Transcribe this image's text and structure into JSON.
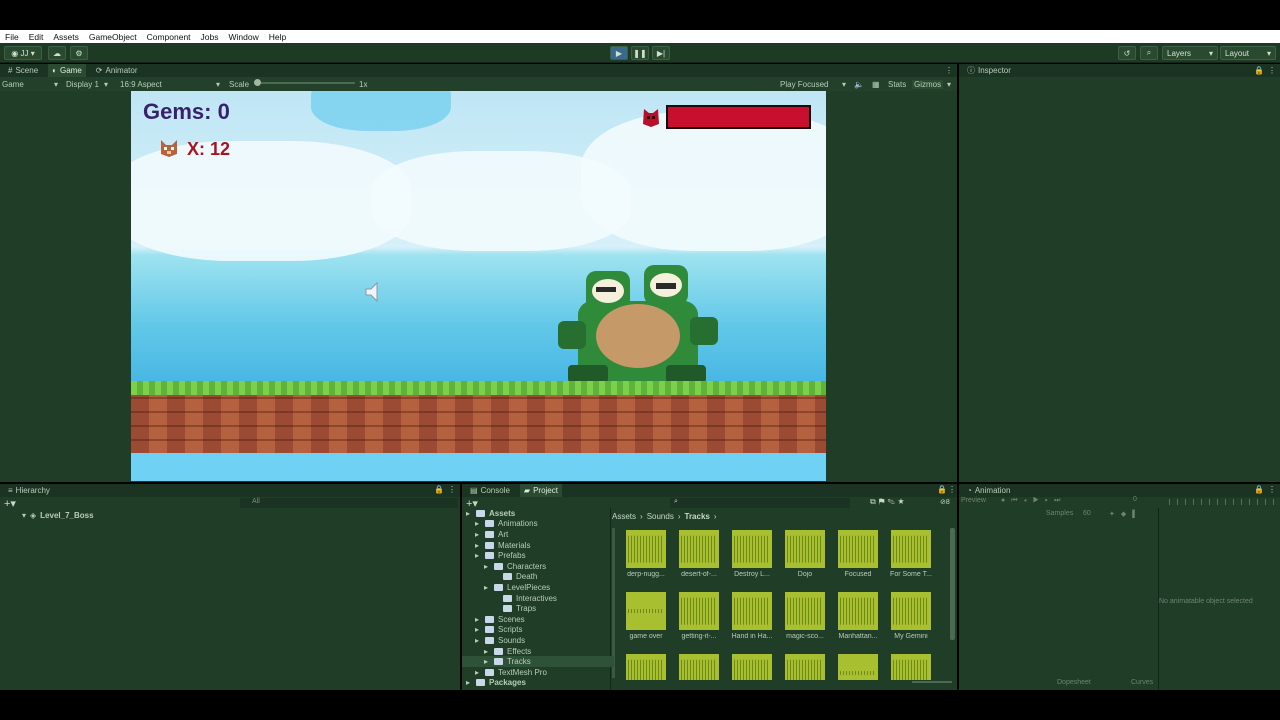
{
  "menu": [
    "File",
    "Edit",
    "Assets",
    "GameObject",
    "Component",
    "Jobs",
    "Window",
    "Help"
  ],
  "toolbar": {
    "account": "JJ",
    "layers": "Layers",
    "layout": "Layout"
  },
  "scene_tabs": {
    "scene": "Scene",
    "game": "Game",
    "animator": "Animator"
  },
  "game_bar": {
    "mode": "Game",
    "display": "Display 1",
    "aspect": "16:9 Aspect",
    "scale_label": "Scale",
    "scale_value": "1x",
    "play_focused": "Play Focused",
    "stats": "Stats",
    "gizmos": "Gizmos"
  },
  "game_hud": {
    "gems": "Gems: 0",
    "lives": "X: 12",
    "boss_health": 1.0
  },
  "inspector": {
    "title": "Inspector"
  },
  "hierarchy": {
    "title": "Hierarchy",
    "search_placeholder": "All",
    "root": "Level_7_Boss"
  },
  "project": {
    "console_tab": "Console",
    "project_tab": "Project",
    "breadcrumb": [
      "Assets",
      "Sounds",
      "Tracks"
    ],
    "tree": [
      {
        "label": "Assets",
        "depth": 0,
        "bold": true
      },
      {
        "label": "Animations",
        "depth": 1
      },
      {
        "label": "Art",
        "depth": 1
      },
      {
        "label": "Materials",
        "depth": 1
      },
      {
        "label": "Prefabs",
        "depth": 1
      },
      {
        "label": "Characters",
        "depth": 2
      },
      {
        "label": "Death",
        "depth": 3
      },
      {
        "label": "LevelPieces",
        "depth": 2
      },
      {
        "label": "Interactives",
        "depth": 3
      },
      {
        "label": "Traps",
        "depth": 3
      },
      {
        "label": "Scenes",
        "depth": 1
      },
      {
        "label": "Scripts",
        "depth": 1
      },
      {
        "label": "Sounds",
        "depth": 1
      },
      {
        "label": "Effects",
        "depth": 2
      },
      {
        "label": "Tracks",
        "depth": 2,
        "selected": true
      },
      {
        "label": "TextMesh Pro",
        "depth": 1
      },
      {
        "label": "Packages",
        "depth": 0,
        "bold": true
      }
    ],
    "assets": [
      "derp-nugg...",
      "desert-of-...",
      "Destroy L...",
      "Dojo",
      "Focused",
      "For Some T...",
      "game over",
      "getting-it-...",
      "Hand in Ha...",
      "magic-sco...",
      "Manhattan...",
      "My Gemini",
      "",
      "",
      "",
      "",
      "",
      ""
    ],
    "hidden_count": "8"
  },
  "animation": {
    "title": "Animation",
    "preview": "Preview",
    "samples_label": "Samples",
    "samples_value": "60",
    "time": "0",
    "empty_msg": "No animatable object selected",
    "dopesheet": "Dopesheet",
    "curves": "Curves"
  },
  "colors": {
    "health": "#c8102e",
    "editor_bg": "#203d28",
    "gems_text": "#3a1f6e",
    "lives_text": "#a8151e"
  }
}
